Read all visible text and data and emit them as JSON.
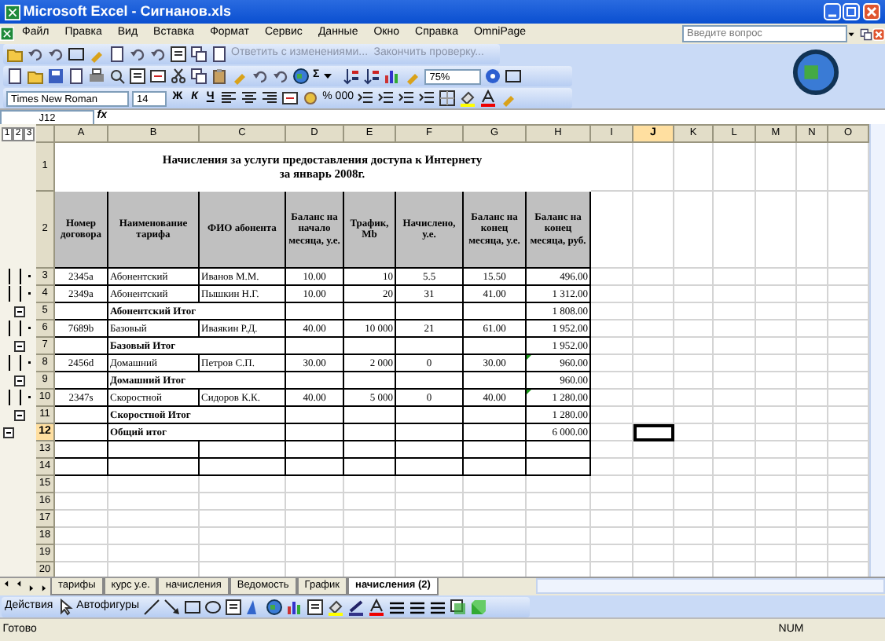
{
  "window": {
    "title": "Microsoft Excel - Сигнанов.xls"
  },
  "menu": [
    "Файл",
    "Правка",
    "Вид",
    "Вставка",
    "Формат",
    "Сервис",
    "Данные",
    "Окно",
    "Справка",
    "OmniPage"
  ],
  "help_box": {
    "placeholder": "Введите вопрос"
  },
  "review_toolbar": {
    "reply": "Ответить с изменениями...",
    "end_review": "Закончить проверку...",
    "disabled": true
  },
  "standard_toolbar": {
    "sum": "Σ",
    "zoom": "75%"
  },
  "formatting_toolbar": {
    "font": "Times New Roman",
    "size": "14",
    "styles": [
      "Ж",
      "К",
      "Ч"
    ],
    "percent": "%",
    "thousands": "000"
  },
  "formula_bar": {
    "name_box": "J12",
    "fx": "fx"
  },
  "outline_levels": [
    "1",
    "2",
    "3"
  ],
  "columns": [
    {
      "letter": "A",
      "selected": false
    },
    {
      "letter": "B",
      "selected": false
    },
    {
      "letter": "C",
      "selected": false
    },
    {
      "letter": "D",
      "selected": false
    },
    {
      "letter": "E",
      "selected": false
    },
    {
      "letter": "F",
      "selected": false
    },
    {
      "letter": "G",
      "selected": false
    },
    {
      "letter": "H",
      "selected": false
    },
    {
      "letter": "I",
      "selected": false
    },
    {
      "letter": "J",
      "selected": true
    },
    {
      "letter": "K",
      "selected": false
    },
    {
      "letter": "L",
      "selected": false
    },
    {
      "letter": "M",
      "selected": false
    },
    {
      "letter": "N",
      "selected": false
    },
    {
      "letter": "O",
      "selected": false
    }
  ],
  "rows": [
    {
      "number": "1",
      "kind": "title",
      "selected": false,
      "lines": [
        "Начисления за услуги предоставления доступа к Интернету",
        "за январь 2008г."
      ]
    },
    {
      "number": "2",
      "kind": "header",
      "selected": false,
      "cells": [
        "Номер договора",
        "Наименование тарифа",
        "ФИО абонента",
        "Баланс на начало месяца, у.е.",
        "Трафик, Mb",
        "Начислено, у.е.",
        "Баланс на конец месяца, у.е.",
        "Баланс на конец месяца, руб."
      ]
    },
    {
      "number": "3",
      "kind": "data",
      "selected": false,
      "flag": false,
      "cells": [
        "2345a",
        "Абонентский",
        "Иванов М.М.",
        "10.00",
        "10",
        "5.5",
        "15.50",
        "496.00"
      ]
    },
    {
      "number": "4",
      "kind": "data",
      "selected": false,
      "flag": false,
      "cells": [
        "2349a",
        "Абонентский",
        "Пышкин Н.Г.",
        "10.00",
        "20",
        "31",
        "41.00",
        "1 312.00"
      ]
    },
    {
      "number": "5",
      "kind": "subtotal",
      "selected": false,
      "label": "Абонентский Итог",
      "value": "1 808.00"
    },
    {
      "number": "6",
      "kind": "data",
      "selected": false,
      "flag": false,
      "cells": [
        "7689b",
        "Базовый",
        "Иваякин Р.Д.",
        "40.00",
        "10 000",
        "21",
        "61.00",
        "1 952.00"
      ]
    },
    {
      "number": "7",
      "kind": "subtotal",
      "selected": false,
      "label": "Базовый Итог",
      "value": "1 952.00"
    },
    {
      "number": "8",
      "kind": "data",
      "selected": false,
      "flag": true,
      "cells": [
        "2456d",
        "Домашний",
        "Петров С.П.",
        "30.00",
        "2 000",
        "0",
        "30.00",
        "960.00"
      ]
    },
    {
      "number": "9",
      "kind": "subtotal",
      "selected": false,
      "label": "Домашний Итог",
      "value": "960.00"
    },
    {
      "number": "10",
      "kind": "data",
      "selected": false,
      "flag": true,
      "cells": [
        "2347s",
        "Скоростной",
        "Сидоров К.К.",
        "40.00",
        "5 000",
        "0",
        "40.00",
        "1 280.00"
      ]
    },
    {
      "number": "11",
      "kind": "subtotal",
      "selected": false,
      "label": "Скоростной Итог",
      "value": "1 280.00"
    },
    {
      "number": "12",
      "kind": "total",
      "selected": true,
      "label": "Общий итог",
      "value": "6 000.00"
    },
    {
      "number": "13",
      "kind": "boxed",
      "selected": false
    },
    {
      "number": "14",
      "kind": "boxed",
      "selected": false
    },
    {
      "number": "15",
      "kind": "blank",
      "selected": false
    },
    {
      "number": "16",
      "kind": "blank",
      "selected": false
    },
    {
      "number": "17",
      "kind": "blank",
      "selected": false
    },
    {
      "number": "18",
      "kind": "blank",
      "selected": false
    },
    {
      "number": "19",
      "kind": "blank",
      "selected": false
    },
    {
      "number": "20",
      "kind": "blank",
      "selected": false
    }
  ],
  "sheet_tabs": [
    {
      "label": "тарифы",
      "selected": false
    },
    {
      "label": "курс у.е.",
      "selected": false
    },
    {
      "label": "начисления",
      "selected": false
    },
    {
      "label": "Ведомость",
      "selected": false
    },
    {
      "label": "График",
      "selected": false
    },
    {
      "label": "начисления (2)",
      "selected": true
    }
  ],
  "drawing_toolbar": {
    "actions": "Действия",
    "autoshapes": "Автофигуры"
  },
  "status_bar": {
    "text": "Готово",
    "num": "NUM"
  }
}
